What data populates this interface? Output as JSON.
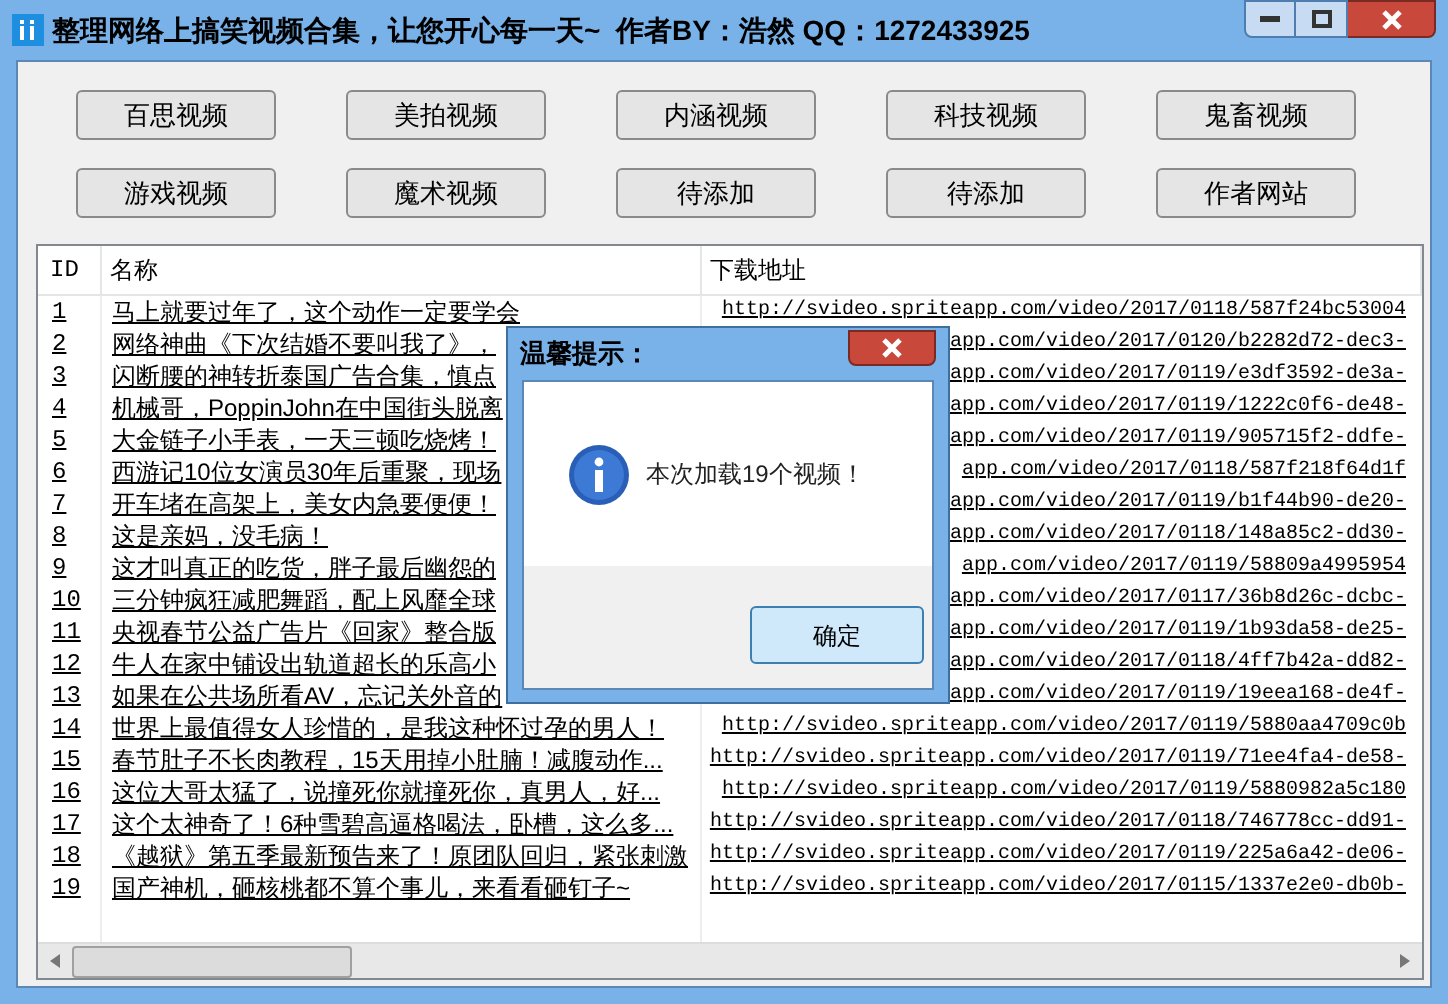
{
  "window": {
    "title": "整理网络上搞笑视频合集，让您开心每一天~  作者BY：浩然 QQ：1272433925"
  },
  "buttons": [
    "百思视频",
    "美拍视频",
    "内涵视频",
    "科技视频",
    "鬼畜视频",
    "游戏视频",
    "魔术视频",
    "待添加",
    "待添加",
    "作者网站"
  ],
  "table": {
    "columns": [
      "ID",
      "名称",
      "下载地址"
    ],
    "rows": [
      {
        "id": "1",
        "name": "马上就要过年了，这个动作一定要学会",
        "url": "http://svideo.spriteapp.com/video/2017/0118/587f24bc53004"
      },
      {
        "id": "2",
        "name": "网络神曲《下次结婚不要叫我了》，",
        "url": "app.com/video/2017/0120/b2282d72-dec3-"
      },
      {
        "id": "3",
        "name": "闪断腰的神转折泰国广告合集，慎点",
        "url": "app.com/video/2017/0119/e3df3592-de3a-"
      },
      {
        "id": "4",
        "name": "机械哥，PoppinJohn在中国街头脱离",
        "url": "app.com/video/2017/0119/1222c0f6-de48-"
      },
      {
        "id": "5",
        "name": "大金链子小手表，一天三顿吃烧烤！",
        "url": "app.com/video/2017/0119/905715f2-ddfe-"
      },
      {
        "id": "6",
        "name": "西游记10位女演员30年后重聚，现场",
        "url": "app.com/video/2017/0118/587f218f64d1f"
      },
      {
        "id": "7",
        "name": "开车堵在高架上，美女内急要便便！",
        "url": "app.com/video/2017/0119/b1f44b90-de20-"
      },
      {
        "id": "8",
        "name": "这是亲妈，没毛病！",
        "url": "app.com/video/2017/0118/148a85c2-dd30-"
      },
      {
        "id": "9",
        "name": "这才叫真正的吃货，胖子最后幽怨的",
        "url": "app.com/video/2017/0119/58809a4995954"
      },
      {
        "id": "10",
        "name": "三分钟疯狂减肥舞蹈，配上风靡全球",
        "url": "app.com/video/2017/0117/36b8d26c-dcbc-"
      },
      {
        "id": "11",
        "name": "央视春节公益广告片《回家》整合版",
        "url": "app.com/video/2017/0119/1b93da58-de25-"
      },
      {
        "id": "12",
        "name": "牛人在家中铺设出轨道超长的乐高小",
        "url": "app.com/video/2017/0118/4ff7b42a-dd82-"
      },
      {
        "id": "13",
        "name": "如果在公共场所看AV，忘记关外音的",
        "url": "app.com/video/2017/0119/19eea168-de4f-"
      },
      {
        "id": "14",
        "name": "世界上最值得女人珍惜的，是我这种怀过孕的男人！",
        "url": "http://svideo.spriteapp.com/video/2017/0119/5880aa4709c0b"
      },
      {
        "id": "15",
        "name": "春节肚子不长肉教程，15天用掉小肚腩！减腹动作...",
        "url": "http://svideo.spriteapp.com/video/2017/0119/71ee4fa4-de58-"
      },
      {
        "id": "16",
        "name": "这位大哥太猛了，说撞死你就撞死你，真男人，好...",
        "url": "http://svideo.spriteapp.com/video/2017/0119/5880982a5c180"
      },
      {
        "id": "17",
        "name": "这个太神奇了！6种雪碧高逼格喝法，卧槽，这么多...",
        "url": "http://svideo.spriteapp.com/video/2017/0118/746778cc-dd91-"
      },
      {
        "id": "18",
        "name": "《越狱》第五季最新预告来了！原团队回归，紧张刺激",
        "url": "http://svideo.spriteapp.com/video/2017/0119/225a6a42-de06-"
      },
      {
        "id": "19",
        "name": "国产神机，砸核桃都不算个事儿，来看看砸钉子~",
        "url": "http://svideo.spriteapp.com/video/2017/0115/1337e2e0-db0b-"
      }
    ]
  },
  "dialog": {
    "title": "温馨提示：",
    "message": "本次加载19个视频！",
    "button": "确定"
  }
}
